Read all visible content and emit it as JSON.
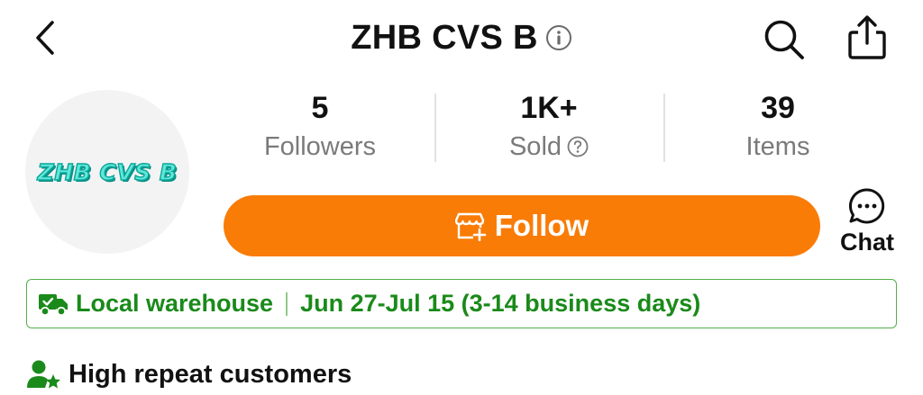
{
  "header": {
    "title": "ZHB CVS B",
    "icons": {
      "back": "chevron-left-icon",
      "info": "info-circle-icon",
      "search": "search-icon",
      "share": "share-icon"
    }
  },
  "shop": {
    "avatar_text": "ZHB CVS B"
  },
  "stats": {
    "followers": {
      "value": "5",
      "label": "Followers"
    },
    "sold": {
      "value": "1K+",
      "label": "Sold"
    },
    "items": {
      "value": "39",
      "label": "Items"
    }
  },
  "actions": {
    "follow_label": "Follow",
    "chat_label": "Chat"
  },
  "warehouse": {
    "name": "Local warehouse",
    "delivery": "Jun 27-Jul 15 (3-14 business days)"
  },
  "badges": {
    "repeat_customers": "High repeat customers"
  },
  "colors": {
    "accent_orange": "#f97c07",
    "green": "#1a8a1a",
    "green_border": "#52b04a",
    "muted_text": "#7a7a7a",
    "avatar_text": "#5fe8d8"
  }
}
